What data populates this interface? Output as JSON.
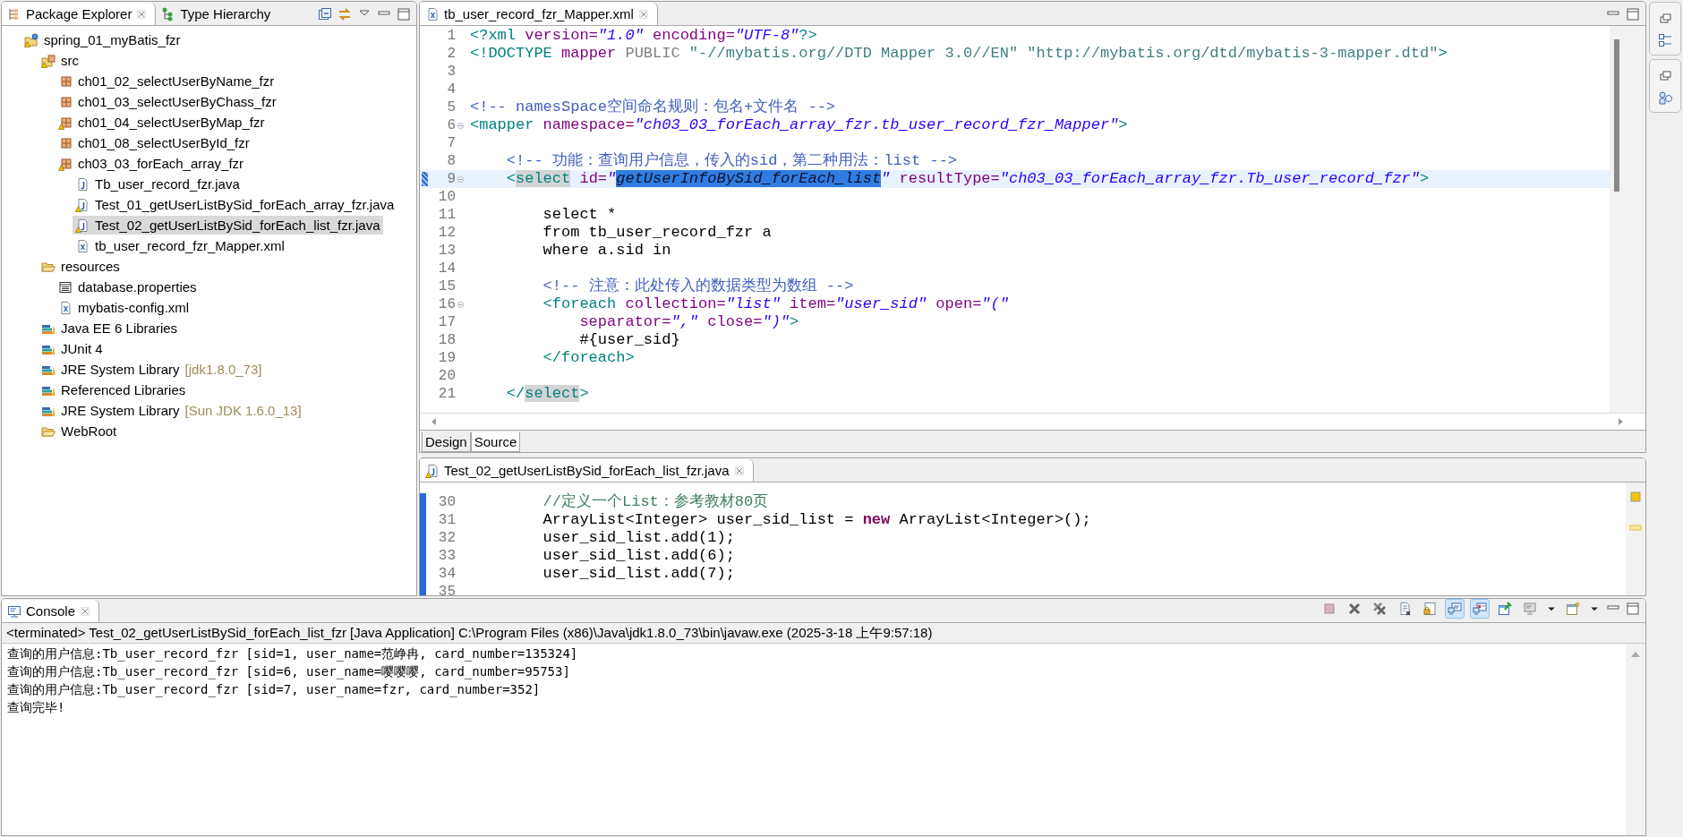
{
  "package_explorer": {
    "tabs": [
      {
        "label": "Package Explorer",
        "kind": "packages",
        "selected": true
      },
      {
        "label": "Type Hierarchy",
        "kind": "hierarchy",
        "selected": false
      }
    ],
    "tree": [
      {
        "label": "spring_01_myBatis_fzr",
        "kind": "project",
        "selected": false,
        "children": [
          {
            "label": "src",
            "kind": "source-folder",
            "selected": false,
            "children": [
              {
                "label": "ch01_02_selectUserByName_fzr",
                "kind": "package",
                "selected": false
              },
              {
                "label": "ch01_03_selectUserByChass_fzr",
                "kind": "package",
                "selected": false
              },
              {
                "label": "ch01_04_selectUserByMap_fzr",
                "kind": "package-warning",
                "selected": false
              },
              {
                "label": "ch01_08_selectUserById_fzr",
                "kind": "package",
                "selected": false
              },
              {
                "label": "ch03_03_forEach_array_fzr",
                "kind": "package-warning",
                "selected": false,
                "children": [
                  {
                    "label": "Tb_user_record_fzr.java",
                    "kind": "java",
                    "selected": false
                  },
                  {
                    "label": "Test_01_getUserListBySid_forEach_array_fzr.java",
                    "kind": "java-warning",
                    "selected": false
                  },
                  {
                    "label": "Test_02_getUserListBySid_forEach_list_fzr.java",
                    "kind": "java-warning",
                    "selected": true
                  },
                  {
                    "label": "tb_user_record_fzr_Mapper.xml",
                    "kind": "xml",
                    "selected": false
                  }
                ]
              }
            ]
          },
          {
            "label": "resources",
            "kind": "folder",
            "selected": false,
            "children": [
              {
                "label": "database.properties",
                "kind": "properties",
                "selected": false
              },
              {
                "label": "mybatis-config.xml",
                "kind": "xml",
                "selected": false
              }
            ]
          },
          {
            "label": "Java EE 6 Libraries",
            "kind": "library",
            "selected": false
          },
          {
            "label": "JUnit 4",
            "kind": "library",
            "selected": false
          },
          {
            "label": "JRE System Library",
            "qualifier": "[jdk1.8.0_73]",
            "kind": "library",
            "selected": false
          },
          {
            "label": "Referenced Libraries",
            "kind": "library",
            "selected": false
          },
          {
            "label": "JRE System Library",
            "qualifier": "[Sun JDK 1.6.0_13]",
            "kind": "library",
            "selected": false
          },
          {
            "label": "WebRoot",
            "kind": "folder",
            "selected": false
          }
        ]
      }
    ]
  },
  "xml_editor": {
    "tab": {
      "label": "tb_user_record_fzr_Mapper.xml"
    },
    "lines": [
      {
        "number": "1",
        "current": false,
        "fold": false,
        "segments": [
          {
            "kind": "tag",
            "text": "<?xml"
          },
          {
            "kind": "attr",
            "text": " version="
          },
          {
            "kind": "value",
            "text": "\"1.0\""
          },
          {
            "kind": "attr",
            "text": " encoding="
          },
          {
            "kind": "value",
            "text": "\"UTF-8\""
          },
          {
            "kind": "tag",
            "text": "?>"
          }
        ]
      },
      {
        "number": "2",
        "current": false,
        "fold": false,
        "segments": [
          {
            "kind": "tag",
            "text": "<!DOCTYPE"
          },
          {
            "kind": "attr",
            "text": " mapper"
          },
          {
            "kind": "keyword",
            "text": " PUBLIC"
          },
          {
            "kind": "string",
            "text": " \"-//mybatis.org//DTD Mapper 3.0//EN\" \"http://mybatis.org/dtd/mybatis-3-mapper.dtd\""
          },
          {
            "kind": "tag",
            "text": ">"
          }
        ]
      },
      {
        "number": "3",
        "current": false,
        "fold": false
      },
      {
        "number": "4",
        "current": false,
        "fold": false
      },
      {
        "number": "5",
        "current": false,
        "fold": false,
        "segments": [
          {
            "kind": "comment",
            "text": "<!-- namesSpace空间命名规则：包名+文件名 -->"
          }
        ]
      },
      {
        "number": "6",
        "current": false,
        "fold": true,
        "segments": [
          {
            "kind": "tag",
            "text": "<mapper"
          },
          {
            "kind": "attr",
            "text": " namespace="
          },
          {
            "kind": "value",
            "text": "\"ch03_03_forEach_array_fzr.tb_user_record_fzr_Mapper\""
          },
          {
            "kind": "tag",
            "text": ">"
          }
        ]
      },
      {
        "number": "7",
        "current": false,
        "fold": false
      },
      {
        "number": "8",
        "current": false,
        "fold": false,
        "segments": [
          {
            "kind": "comment",
            "text": "    <!-- 功能：查询用户信息，传入的sid，第二种用法：list -->"
          }
        ]
      },
      {
        "number": "9",
        "current": true,
        "fold": true,
        "segments": [
          {
            "kind": "tag",
            "text": "    <"
          },
          {
            "kind": "match",
            "text": "select"
          },
          {
            "kind": "attr",
            "text": " id="
          },
          {
            "kind": "value",
            "text": "\""
          },
          {
            "kind": "selection",
            "text": "getUserInfoBySid_forEach_list"
          },
          {
            "kind": "value",
            "text": "\""
          },
          {
            "kind": "attr",
            "text": " resultType="
          },
          {
            "kind": "value",
            "text": "\"ch03_03_forEach_array_fzr.Tb_user_record_fzr\""
          },
          {
            "kind": "tag",
            "text": ">"
          }
        ]
      },
      {
        "number": "10",
        "current": false,
        "fold": false
      },
      {
        "number": "11",
        "current": false,
        "fold": false,
        "segments": [
          {
            "kind": "text",
            "text": "        select *"
          }
        ]
      },
      {
        "number": "12",
        "current": false,
        "fold": false,
        "segments": [
          {
            "kind": "text",
            "text": "        from tb_user_record_fzr a"
          }
        ]
      },
      {
        "number": "13",
        "current": false,
        "fold": false,
        "segments": [
          {
            "kind": "text",
            "text": "        where a.sid in"
          }
        ]
      },
      {
        "number": "14",
        "current": false,
        "fold": false
      },
      {
        "number": "15",
        "current": false,
        "fold": false,
        "segments": [
          {
            "kind": "comment",
            "text": "        <!-- 注意：此处传入的数据类型为数组 -->"
          }
        ]
      },
      {
        "number": "16",
        "current": false,
        "fold": true,
        "segments": [
          {
            "kind": "tag",
            "text": "        <foreach"
          },
          {
            "kind": "attr",
            "text": " collection="
          },
          {
            "kind": "value",
            "text": "\"list\""
          },
          {
            "kind": "attr",
            "text": " item="
          },
          {
            "kind": "value",
            "text": "\"user_sid\""
          },
          {
            "kind": "attr",
            "text": " open="
          },
          {
            "kind": "value",
            "text": "\"(\""
          }
        ]
      },
      {
        "number": "17",
        "current": false,
        "fold": false,
        "segments": [
          {
            "kind": "attr",
            "text": "            separator="
          },
          {
            "kind": "value",
            "text": "\",\""
          },
          {
            "kind": "attr",
            "text": " close="
          },
          {
            "kind": "value",
            "text": "\")\""
          },
          {
            "kind": "tag",
            "text": ">"
          }
        ]
      },
      {
        "number": "18",
        "current": false,
        "fold": false,
        "segments": [
          {
            "kind": "text",
            "text": "            #{user_sid}"
          }
        ]
      },
      {
        "number": "19",
        "current": false,
        "fold": false,
        "segments": [
          {
            "kind": "tag",
            "text": "        </foreach>"
          }
        ]
      },
      {
        "number": "20",
        "current": false,
        "fold": false
      },
      {
        "number": "21",
        "current": false,
        "fold": false,
        "segments": [
          {
            "kind": "tag",
            "text": "    </"
          },
          {
            "kind": "match",
            "text": "select"
          },
          {
            "kind": "tag",
            "text": ">"
          }
        ]
      }
    ],
    "mode_tabs": [
      {
        "label": "Design",
        "selected": false
      },
      {
        "label": "Source",
        "selected": true
      }
    ]
  },
  "java_editor": {
    "tab": {
      "label": "Test_02_getUserListBySid_forEach_list_fzr.java"
    },
    "lines": [
      {
        "number": "30",
        "current": false,
        "fold": false,
        "segments": [
          {
            "kind": "java-comment",
            "text": "        //定义一个List：参考教材80页"
          }
        ]
      },
      {
        "number": "31",
        "current": false,
        "fold": false,
        "segments": [
          {
            "kind": "text",
            "text": "        ArrayList<Integer> user_sid_list = "
          },
          {
            "kind": "java-keyword",
            "text": "new"
          },
          {
            "kind": "text",
            "text": " ArrayList<Integer>();"
          }
        ]
      },
      {
        "number": "32",
        "current": false,
        "fold": false,
        "segments": [
          {
            "kind": "text",
            "text": "        user_sid_list.add(1);"
          }
        ]
      },
      {
        "number": "33",
        "current": false,
        "fold": false,
        "segments": [
          {
            "kind": "text",
            "text": "        user_sid_list.add(6);"
          }
        ]
      },
      {
        "number": "34",
        "current": false,
        "fold": false,
        "segments": [
          {
            "kind": "text",
            "text": "        user_sid_list.add(7);"
          }
        ]
      },
      {
        "number": "35",
        "current": false,
        "fold": false
      }
    ]
  },
  "console": {
    "tab": {
      "label": "Console"
    },
    "toolbar": [
      {
        "kind": "terminate",
        "pressed": false
      },
      {
        "kind": "remove-launch",
        "pressed": false
      },
      {
        "kind": "remove-all",
        "pressed": false
      },
      {
        "kind": "clear",
        "pressed": false
      },
      {
        "kind": "scroll-lock",
        "pressed": false
      },
      {
        "kind": "show-stdout",
        "pressed": true
      },
      {
        "kind": "show-stderr",
        "pressed": true
      },
      {
        "kind": "pin",
        "pressed": false
      },
      {
        "kind": "display",
        "pressed": false
      },
      {
        "kind": "menu",
        "pressed": false
      },
      {
        "kind": "new-console",
        "pressed": false
      },
      {
        "kind": "menu",
        "pressed": false
      }
    ],
    "header": "<terminated> Test_02_getUserListBySid_forEach_list_fzr [Java Application] C:\\Program Files (x86)\\Java\\jdk1.8.0_73\\bin\\javaw.exe (2025-3-18 上午9:57:18)",
    "output": [
      "查询的用户信息:Tb_user_record_fzr [sid=1, user_name=范峥冉, card_number=135324]",
      "查询的用户信息:Tb_user_record_fzr [sid=6, user_name=嘤嘤嘤, card_number=95753]",
      "查询的用户信息:Tb_user_record_fzr [sid=7, user_name=fzr, card_number=352]",
      "查询完毕!"
    ]
  }
}
